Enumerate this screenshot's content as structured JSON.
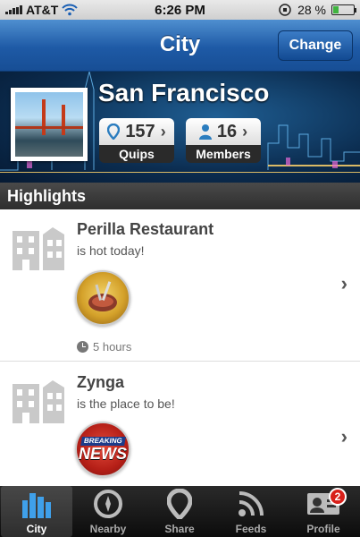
{
  "status_bar": {
    "carrier": "AT&T",
    "time": "6:26 PM",
    "battery": "28 %",
    "battery_level": 0.28
  },
  "navbar": {
    "title": "City",
    "change_label": "Change"
  },
  "city": {
    "name": "San Francisco",
    "quips_count": "157",
    "quips_label": "Quips",
    "members_count": "16",
    "members_label": "Members"
  },
  "section": {
    "title": "Highlights"
  },
  "feed": [
    {
      "name": "Perilla Restaurant",
      "subtitle": "is hot today!",
      "badge_icon": "steak-badge-icon",
      "time": "5 hours"
    },
    {
      "name": "Zynga",
      "subtitle": "is the place to be!",
      "badge_icon": "breaking-news-badge-icon",
      "badge_text_top": "BREAKING",
      "badge_text_main": "NEWS"
    }
  ],
  "tabbar": {
    "tabs": [
      {
        "label": "City",
        "icon": "city-icon",
        "active": true
      },
      {
        "label": "Nearby",
        "icon": "compass-icon"
      },
      {
        "label": "Share",
        "icon": "location-pin-icon"
      },
      {
        "label": "Feeds",
        "icon": "rss-icon"
      },
      {
        "label": "Profile",
        "icon": "id-card-icon",
        "badge": "2"
      }
    ]
  },
  "colors": {
    "nav_blue": "#1e5aa6",
    "tab_bg": "#0c0c0c",
    "notif_red": "#d8201a"
  }
}
